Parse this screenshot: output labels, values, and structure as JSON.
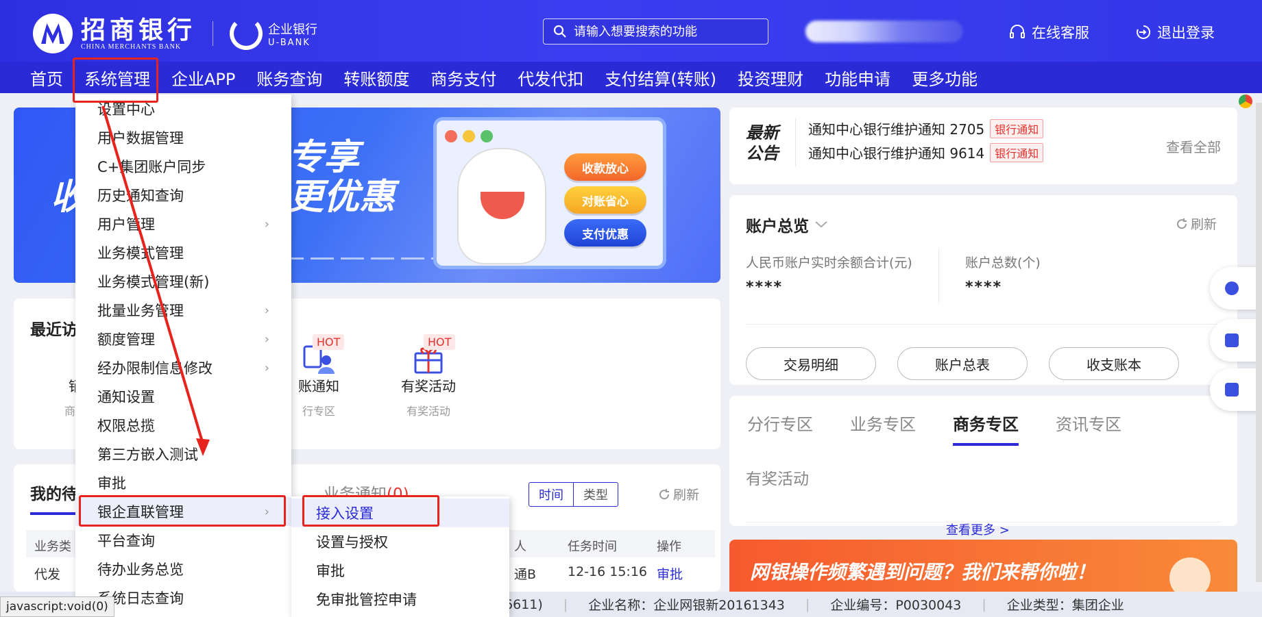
{
  "header": {
    "logo_cn": "招商银行",
    "logo_en": "CHINA MERCHANTS BANK",
    "ubank_cn": "企业银行",
    "ubank_en": "U-BANK",
    "search_placeholder": "请输入想要搜索的功能",
    "service_label": "在线客服",
    "logout_label": "退出登录"
  },
  "nav": {
    "items": [
      "首页",
      "系统管理",
      "企业APP",
      "账务查询",
      "转账额度",
      "商务支付",
      "代发代扣",
      "支付结算(转账)",
      "投资理财",
      "功能申请",
      "更多功能"
    ]
  },
  "menu": {
    "items": [
      {
        "label": "设置中心",
        "has_sub": false
      },
      {
        "label": "用户数据管理",
        "has_sub": false
      },
      {
        "label": "C+集团账户同步",
        "has_sub": false
      },
      {
        "label": "历史通知查询",
        "has_sub": false
      },
      {
        "label": "用户管理",
        "has_sub": true
      },
      {
        "label": "业务模式管理",
        "has_sub": false
      },
      {
        "label": "业务模式管理(新)",
        "has_sub": false
      },
      {
        "label": "批量业务管理",
        "has_sub": true
      },
      {
        "label": "额度管理",
        "has_sub": true
      },
      {
        "label": "经办限制信息修改",
        "has_sub": true
      },
      {
        "label": "通知设置",
        "has_sub": false
      },
      {
        "label": "权限总揽",
        "has_sub": false
      },
      {
        "label": "第三方嵌入测试",
        "has_sub": false
      },
      {
        "label": "审批",
        "has_sub": false
      },
      {
        "label": "银企直联管理",
        "has_sub": true
      },
      {
        "label": "平台查询",
        "has_sub": false
      },
      {
        "label": "待办业务总览",
        "has_sub": false
      },
      {
        "label": "系统日志查询",
        "has_sub": false
      }
    ],
    "active_index": 14
  },
  "submenu": {
    "items": [
      "接入设置",
      "设置与授权",
      "审批",
      "免审批管控申请"
    ],
    "active_index": 0
  },
  "banner": {
    "text_top": "专享",
    "text_bottom": "更优惠",
    "text_left": "收",
    "pill_1": "收款放心",
    "pill_2": "对账省心",
    "pill_3": "支付优惠"
  },
  "notice": {
    "title_top": "最新",
    "title_bottom": "公告",
    "items": [
      {
        "text": "通知中心银行维护通知 2705",
        "tag": "银行通知"
      },
      {
        "text": "通知中心银行维护通知 9614",
        "tag": "银行通知"
      }
    ],
    "view_all": "查看全部"
  },
  "account": {
    "title": "账户总览",
    "refresh": "刷新",
    "balance_label": "人民币账户实时余额合计(元)",
    "balance_value": "****",
    "count_label": "账户总数(个)",
    "count_value": "****",
    "buttons": [
      "交易明细",
      "账户总表",
      "收支账本"
    ]
  },
  "zones": {
    "tabs": [
      "分行专区",
      "业务专区",
      "商务专区",
      "资讯专区"
    ],
    "active_index": 2,
    "content": "有奖活动",
    "more": "查看更多 >"
  },
  "promo": {
    "text": "网银操作频繁遇到问题？我们来帮你啦！"
  },
  "recent": {
    "title": "最近访",
    "items": [
      {
        "label": "销",
        "sub": "商务"
      },
      {
        "label": "账通知",
        "sub": "行专区",
        "hot": "HOT"
      },
      {
        "label": "有奖活动",
        "sub": "有奖活动",
        "hot": "HOT"
      }
    ]
  },
  "todo": {
    "title": "我的待",
    "tab2": "业务通知",
    "tab2_count": "(0)",
    "toggle": [
      "时间",
      "类型"
    ],
    "refresh": "刷新",
    "columns": [
      "业务类",
      "人",
      "任务时间",
      "操作"
    ],
    "row": {
      "type": "代发",
      "person": "通B",
      "time": "12-16 15:16",
      "action": "审批"
    }
  },
  "footer": {
    "left": "6611)",
    "company_name": "企业名称：企业网银新20161343",
    "company_no": "企业编号：P0030043",
    "company_type": "企业类型：集团企业"
  },
  "status_tip": "javascript:void(0)",
  "colors": {
    "brand": "#2a2bd6",
    "accent_red": "#e8221c",
    "hot_red": "#e5322d"
  }
}
